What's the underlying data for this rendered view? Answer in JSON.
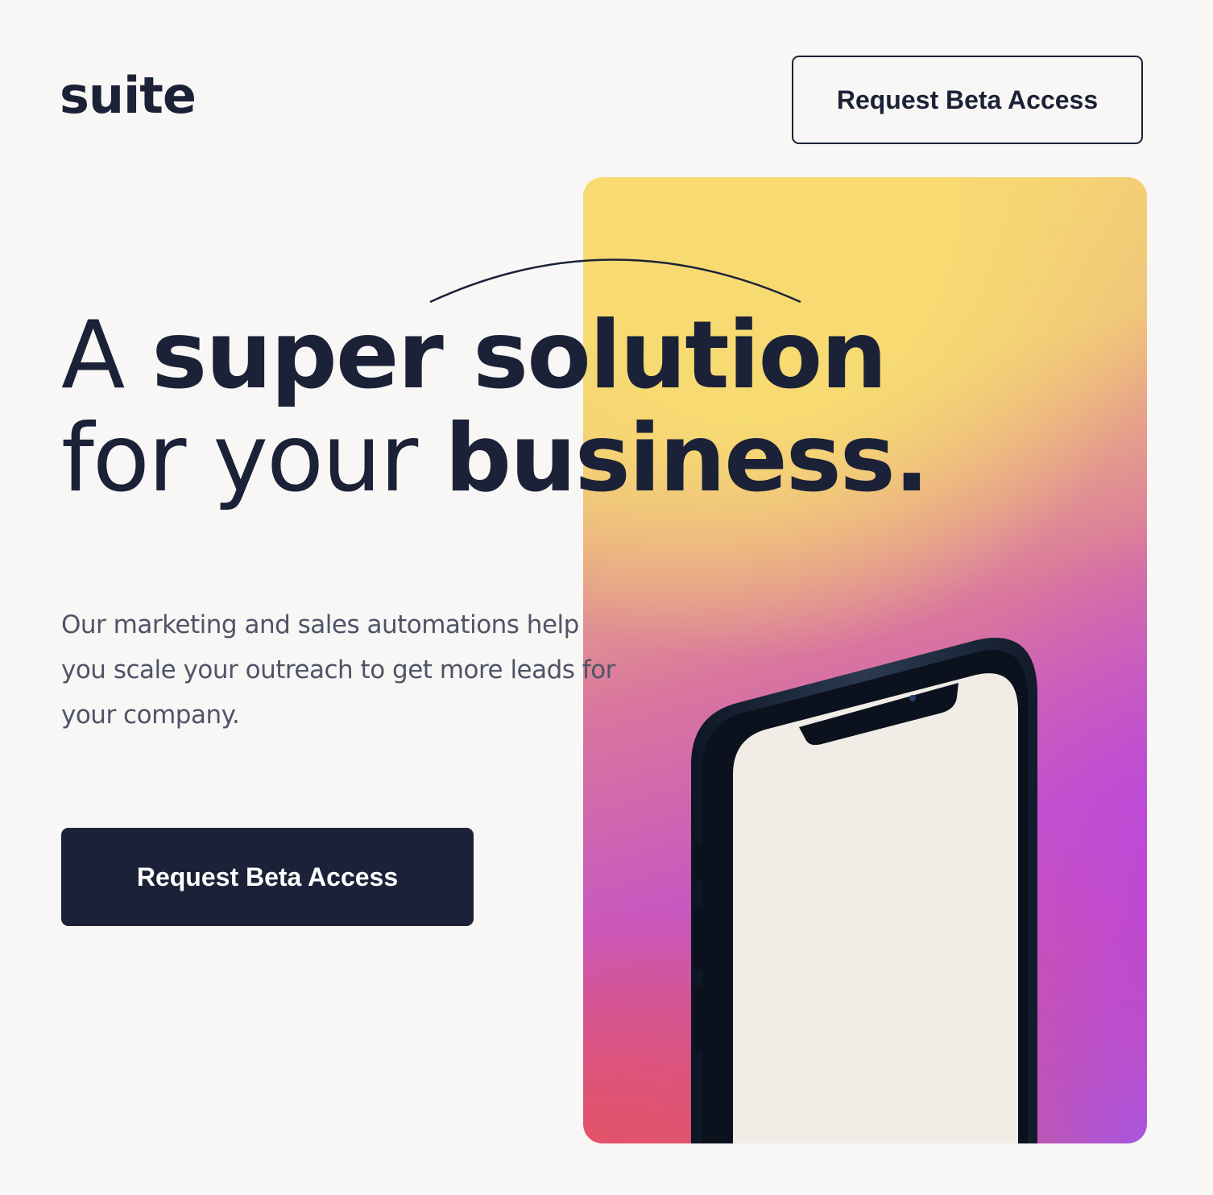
{
  "header": {
    "logo_text": "suite",
    "cta_label": "Request Beta Access"
  },
  "hero": {
    "headline_line1_light": "A",
    "headline_line1_bold": "super solution",
    "headline_line2_light": "for your",
    "headline_line2_bold": "business.",
    "description": "Our marketing and sales automations help you scale your outreach to get more leads for your company.",
    "cta_label": "Request Beta Access"
  },
  "colors": {
    "background": "#f9f7f5",
    "primary_text": "#1b2238",
    "body_text": "#4e5468",
    "button_bg": "#1b2238",
    "gradient_yellow": "#f6d673",
    "gradient_magenta": "#c857c0",
    "gradient_red": "#e35468",
    "gradient_violet": "#965ff0",
    "chart_bar_pink": "#e97bb8"
  },
  "illustration": {
    "icon": "phone-chart-illustration"
  }
}
